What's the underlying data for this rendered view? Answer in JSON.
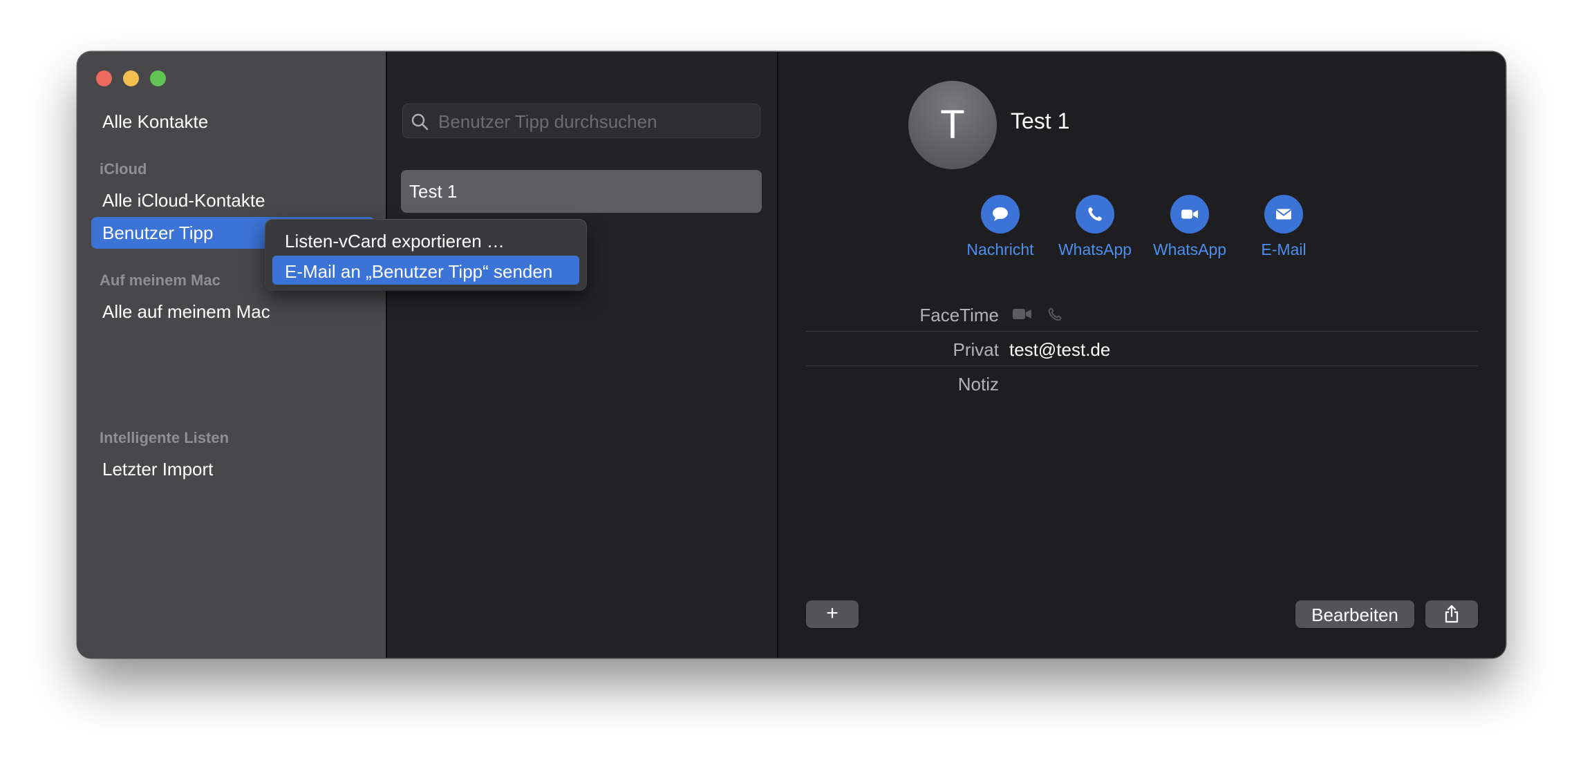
{
  "sidebar": {
    "all_contacts": "Alle Kontakte",
    "icloud_header": "iCloud",
    "all_icloud": "Alle iCloud-Kontakte",
    "selected_group": "Benutzer Tipp",
    "mac_header": "Auf meinem Mac",
    "all_mac": "Alle auf meinem Mac",
    "smart_header": "Intelligente Listen",
    "last_import": "Letzter Import"
  },
  "context_menu": {
    "items": [
      {
        "label": "Listen-vCard exportieren …",
        "highlighted": false
      },
      {
        "label": "E-Mail an „Benutzer Tipp“ senden",
        "highlighted": true
      }
    ]
  },
  "list": {
    "search_placeholder": "Benutzer Tipp durchsuchen",
    "rows": [
      "Test 1"
    ]
  },
  "detail": {
    "avatar_initial": "T",
    "name": "Test 1",
    "actions": [
      {
        "label": "Nachricht",
        "icon": "message-bubble-icon"
      },
      {
        "label": "WhatsApp",
        "icon": "phone-icon"
      },
      {
        "label": "WhatsApp",
        "icon": "video-camera-icon"
      },
      {
        "label": "E-Mail",
        "icon": "envelope-icon"
      }
    ],
    "fields": {
      "facetime_label": "FaceTime",
      "privat_label": "Privat",
      "privat_value": "test@test.de",
      "notiz_label": "Notiz"
    }
  },
  "footer": {
    "add_label": "+",
    "edit_label": "Bearbeiten"
  },
  "colors": {
    "accent": "#3b73d6",
    "link": "#4d8ef0",
    "sidebar_bg": "#48484b",
    "window_bg": "#1e1e21"
  }
}
